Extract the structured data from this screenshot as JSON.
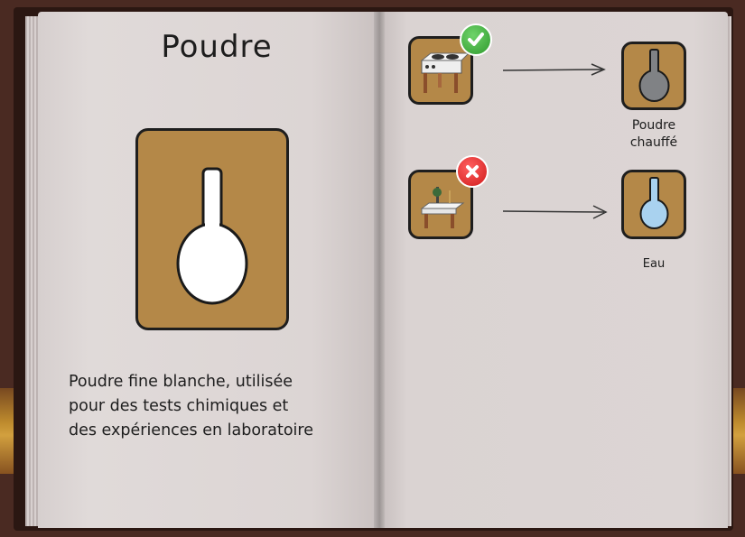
{
  "item": {
    "title": "Poudre",
    "description_lines": [
      "Poudre fine blanche, utilisée",
      "pour des tests chimiques et",
      "des expériences en laboratoire"
    ],
    "icon": "flask-white-icon",
    "card_color": "#b48848",
    "flask_color": "#ffffff"
  },
  "recipes": [
    {
      "station_icon": "hot-plate-stove-icon",
      "status": "available",
      "status_icon": "check-icon",
      "result_label_lines": [
        "Poudre",
        "chauffé"
      ],
      "result_icon": "flask-gray-icon",
      "result_color": "#808285"
    },
    {
      "station_icon": "lab-workbench-icon",
      "status": "unavailable",
      "status_icon": "cross-icon",
      "result_label_lines": [
        "Eau"
      ],
      "result_icon": "flask-lightblue-icon",
      "result_color": "#a9d2ef"
    }
  ]
}
